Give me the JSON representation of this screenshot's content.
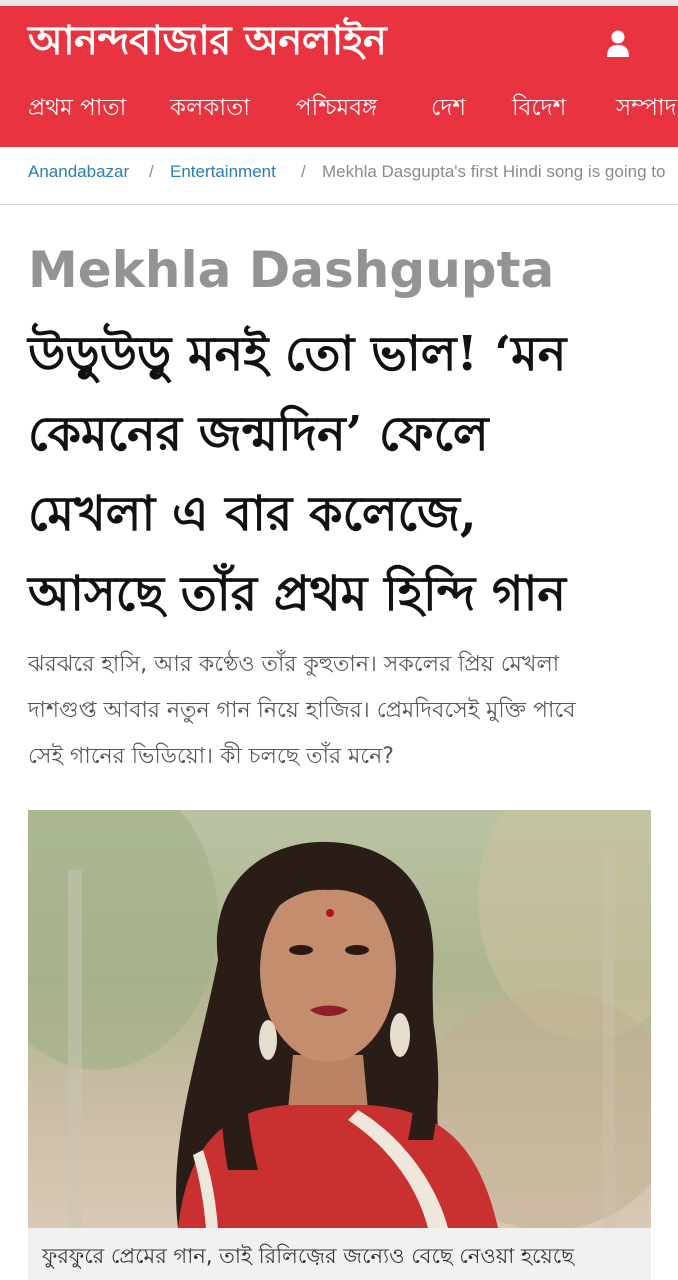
{
  "header": {
    "logo_text": "আনন্দবাজার অনলাইন",
    "user_icon": "user-icon",
    "background_color": "#ea3341"
  },
  "nav": {
    "items": [
      {
        "label": "প্রথম পাতা"
      },
      {
        "label": "কলকাতা"
      },
      {
        "label": "পশ্চিমবঙ্গ"
      },
      {
        "label": "দেশ"
      },
      {
        "label": "বিদেশ"
      },
      {
        "label": "সম্পাদ"
      }
    ]
  },
  "breadcrumb": {
    "items": [
      {
        "label": "Anandabazar"
      },
      {
        "label": "Entertainment"
      },
      {
        "label": "Mekhla Dasgupta's first Hindi song is going to"
      }
    ],
    "separator": "/",
    "link_color": "#2a7db3"
  },
  "article": {
    "kicker": "Mekhla Dashgupta",
    "headline_lines": [
      "উড়ুউড়ু মনই তো ভাল! ‘মন",
      "কেমনের জন্মদিন’ ফেলে",
      "মেখলা এ বার কলেজে,",
      "আসছে তাঁর প্রথম হিন্দি গান"
    ],
    "summary_lines": [
      "ঝরঝরে হাসি, আর কণ্ঠেও তাঁর কুহুতান। সকলের প্রিয় মেখলা",
      "দাশগুপ্ত আবার নতুন গান নিয়ে হাজির। প্রেমদিবসেই মুক্তি পাবে",
      "সেই গানের ভিডিয়ো। কী চলছে তাঁর মনে?"
    ],
    "image_caption": "ফুরফুরে প্রেমের গান, তাই রিলিজ়ের জন্যেও বেছে নেওয়া হয়েছে"
  }
}
